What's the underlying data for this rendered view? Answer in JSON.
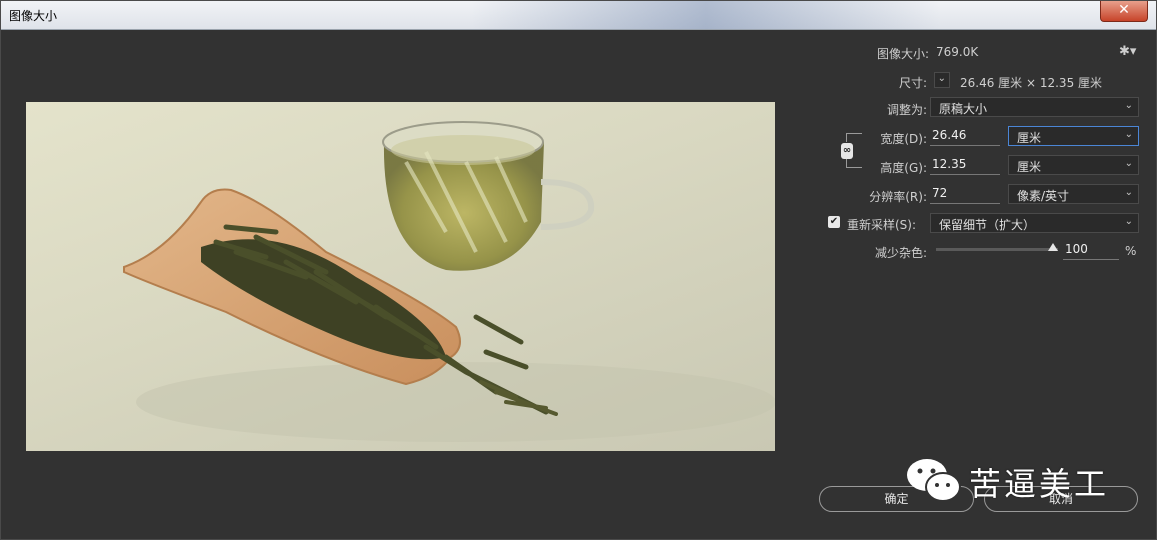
{
  "window": {
    "title": "图像大小",
    "close_glyph": "✕"
  },
  "panel": {
    "image_size_label": "图像大小:",
    "image_size_value": "769.0K",
    "gear_icon": "gear-icon",
    "dimensions_label": "尺寸:",
    "dimensions_value": "26.46 厘米  ×  12.35 厘米",
    "fit_label": "调整为:",
    "fit_value": "原稿大小",
    "width_label": "宽度(D):",
    "width_value": "26.46",
    "width_unit": "厘米",
    "height_label": "高度(G):",
    "height_value": "12.35",
    "height_unit": "厘米",
    "resolution_label": "分辨率(R):",
    "resolution_value": "72",
    "resolution_unit": "像素/英寸",
    "resample_label": "重新采样(S):",
    "resample_checked": true,
    "resample_value": "保留细节（扩大）",
    "noise_label": "减少杂色:",
    "noise_value": "100",
    "noise_unit": "%"
  },
  "buttons": {
    "ok": "确定",
    "cancel": "取消"
  },
  "watermark": {
    "text": "苦逼美工"
  },
  "colors": {
    "background": "#323232",
    "focus_border": "#4b86d6",
    "close_red": "#c7442a"
  }
}
